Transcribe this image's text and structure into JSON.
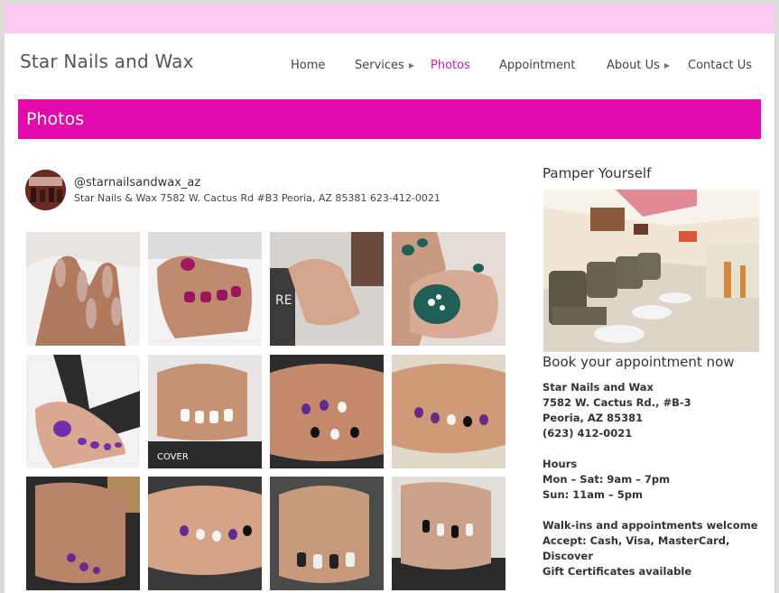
{
  "site": {
    "title": "Star Nails and Wax"
  },
  "nav": {
    "items": [
      {
        "label": "Home"
      },
      {
        "label": "Services"
      },
      {
        "label": "Photos"
      },
      {
        "label": "Appointment"
      },
      {
        "label": "About Us"
      },
      {
        "label": "Contact Us"
      }
    ],
    "submenu_icon": "chevron-right-icon",
    "active_color": "#cc1ea8"
  },
  "hero": {
    "title": "Photos",
    "color": "#e30aad"
  },
  "topbar": {
    "color": "#fdc9f0"
  },
  "instagram": {
    "handle": "@starnailsandwax_az",
    "description": "Star Nails & Wax 7582 W. Cactus Rd #B3 Peoria, AZ 85381 623-412-0021"
  },
  "photos": [
    {
      "name": "nail-photo-1"
    },
    {
      "name": "nail-photo-2"
    },
    {
      "name": "nail-photo-3"
    },
    {
      "name": "nail-photo-4"
    },
    {
      "name": "nail-photo-5"
    },
    {
      "name": "nail-photo-6"
    },
    {
      "name": "nail-photo-7"
    },
    {
      "name": "nail-photo-8"
    },
    {
      "name": "nail-photo-9"
    },
    {
      "name": "nail-photo-10"
    },
    {
      "name": "nail-photo-11"
    },
    {
      "name": "nail-photo-12"
    }
  ],
  "sidebar": {
    "pamper_heading": "Pamper Yourself",
    "book_heading": "Book your appointment now",
    "info_lines": [
      "Star Nails and Wax",
      "7582 W. Cactus Rd., #B-3",
      "Peoria, AZ 85381",
      "(623) 412-0021",
      "Hours",
      "Mon – Sat: 9am – 7pm",
      "Sun: 11am – 5pm",
      "Walk-ins and appointments welcome",
      "Accept: Cash, Visa, MasterCard,",
      "Discover",
      "Gift Certificates available"
    ]
  }
}
